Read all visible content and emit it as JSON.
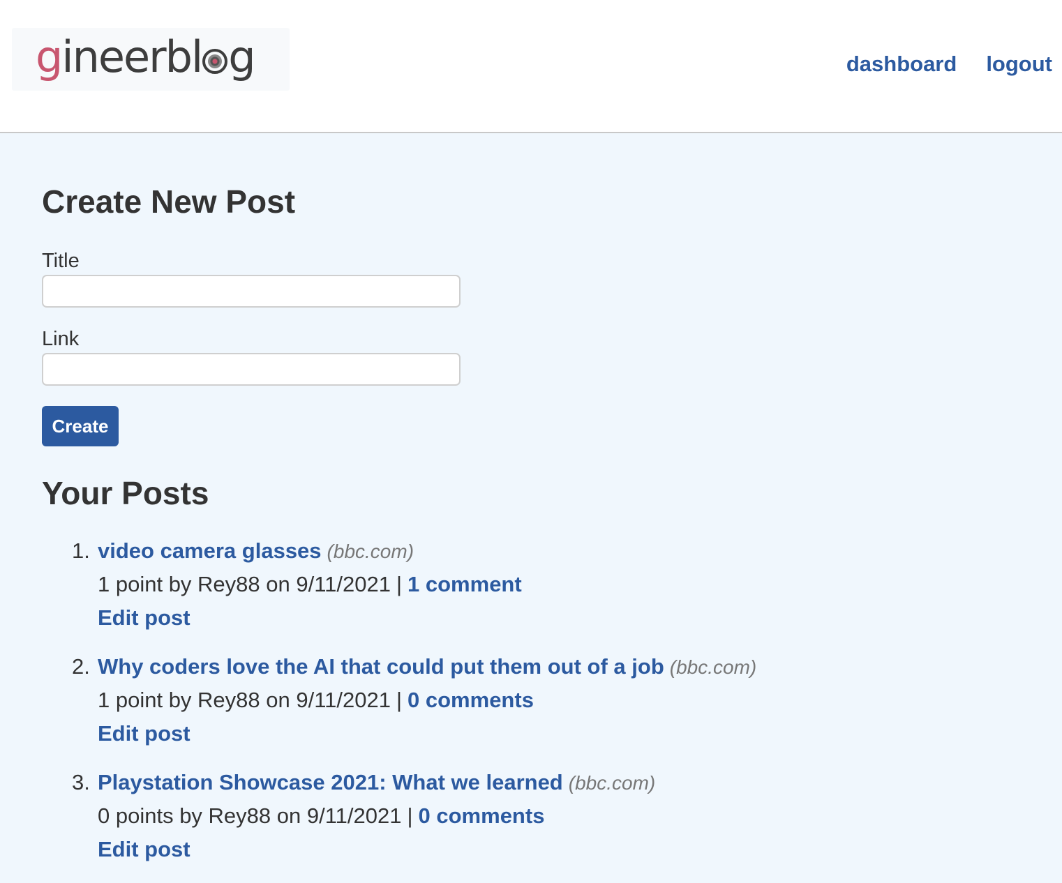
{
  "header": {
    "logo": {
      "g": "g",
      "ineerbl": "ineerbl",
      "tail": "g"
    },
    "nav": {
      "dashboard": "dashboard",
      "logout": "logout"
    }
  },
  "create_form": {
    "heading": "Create New Post",
    "title_label": "Title",
    "title_value": "",
    "link_label": "Link",
    "link_value": "",
    "submit_label": "Create"
  },
  "posts_section": {
    "heading": "Your Posts",
    "posts": [
      {
        "number": "1.",
        "title": "video camera glasses",
        "domain": "(bbc.com)",
        "meta": "1 point by Rey88 on 9/11/2021",
        "separator": "|",
        "comments": "1 comment",
        "edit": "Edit post"
      },
      {
        "number": "2.",
        "title": "Why coders love the AI that could put them out of a job",
        "domain": "(bbc.com)",
        "meta": "1 point by Rey88 on 9/11/2021",
        "separator": "|",
        "comments": "0 comments",
        "edit": "Edit post"
      },
      {
        "number": "3.",
        "title": "Playstation Showcase 2021: What we learned",
        "domain": "(bbc.com)",
        "meta": "0 points by Rey88 on 9/11/2021",
        "separator": "|",
        "comments": "0 comments",
        "edit": "Edit post"
      }
    ]
  },
  "colors": {
    "link": "#2c5aa0",
    "page_background": "#f0f7fd",
    "logo_accent": "#c8566f"
  }
}
